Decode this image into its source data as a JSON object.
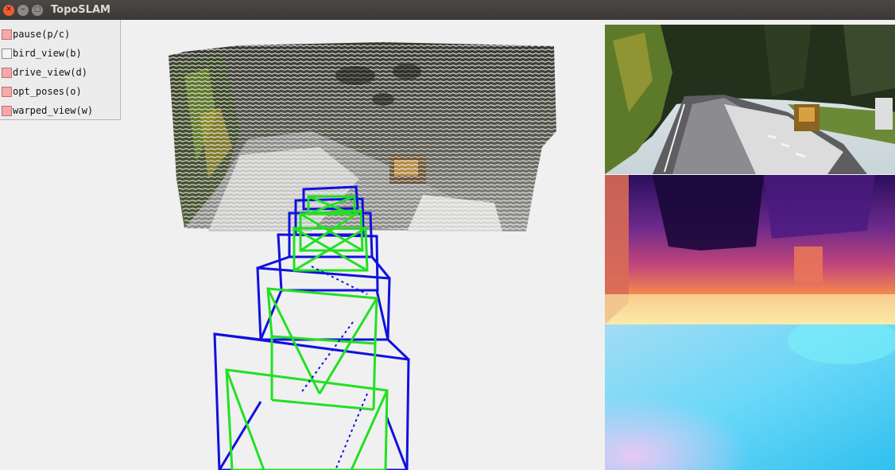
{
  "window": {
    "title": "TopoSLAM",
    "buttons": {
      "close": "✕",
      "minimize": "–",
      "maximize": "□"
    }
  },
  "panel": {
    "options": [
      {
        "label": "pause(p/c)",
        "checked": true
      },
      {
        "label": "bird_view(b)",
        "checked": false
      },
      {
        "label": "drive_view(d)",
        "checked": true
      },
      {
        "label": "opt_poses(o)",
        "checked": true
      },
      {
        "label": "warped_view(w)",
        "checked": true
      }
    ]
  },
  "colors": {
    "background": "#f0f0f0",
    "camera_frame": "#1010e0",
    "optimized_frame": "#22e022",
    "checkbox_on": "#f4aaaa"
  },
  "views": {
    "rgb_image": "camera-frame",
    "depth_image": "depth-map",
    "flow_image": "optical-flow"
  }
}
